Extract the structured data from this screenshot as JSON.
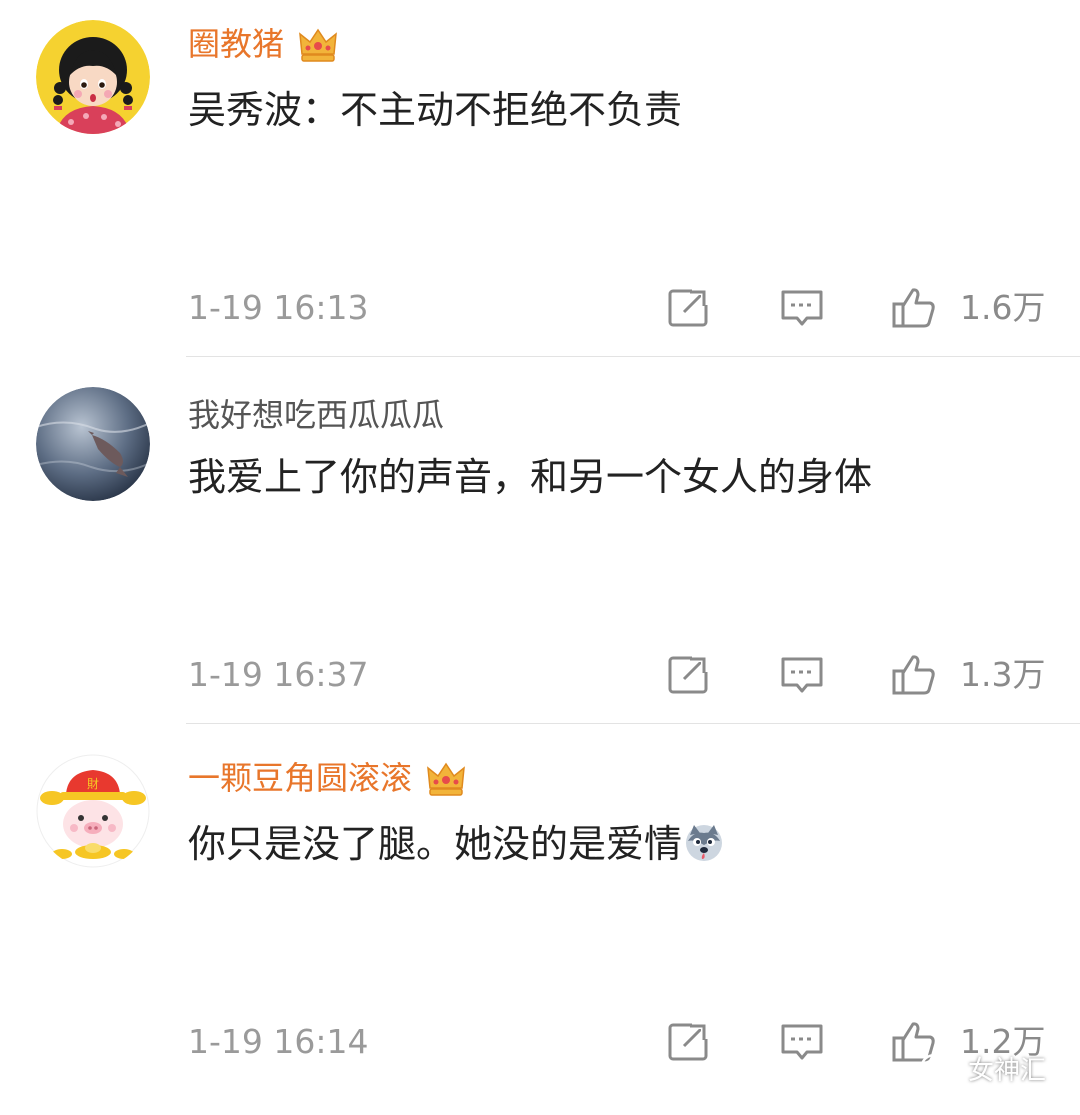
{
  "comments": [
    {
      "username": "圈教猪",
      "vip": true,
      "content": "吴秀波：不主动不拒绝不负责",
      "time": "1-19 16:13",
      "likes": "1.6万",
      "avatar": "cartoon-girl-avatar"
    },
    {
      "username": "我好想吃西瓜瓜瓜",
      "vip": false,
      "content": "我爱上了你的声音，和另一个女人的身体",
      "time": "1-19 16:37",
      "likes": "1.3万",
      "avatar": "whale-photo-avatar"
    },
    {
      "username": "一颗豆角圆滚滚",
      "vip": true,
      "content": "你只是没了腿。她没的是爱情",
      "time": "1-19 16:14",
      "likes": "1.2万",
      "avatar": "fortune-pig-avatar",
      "emoji": "husky-emoji"
    }
  ],
  "watermark": {
    "text": "女神汇"
  },
  "colors": {
    "vip_name": "#e8762b",
    "normal_name": "#555555",
    "content_text": "#222222",
    "meta_text": "#9a9a9a",
    "icon_stroke": "#8a8a8a",
    "divider": "#e3e3e3"
  }
}
